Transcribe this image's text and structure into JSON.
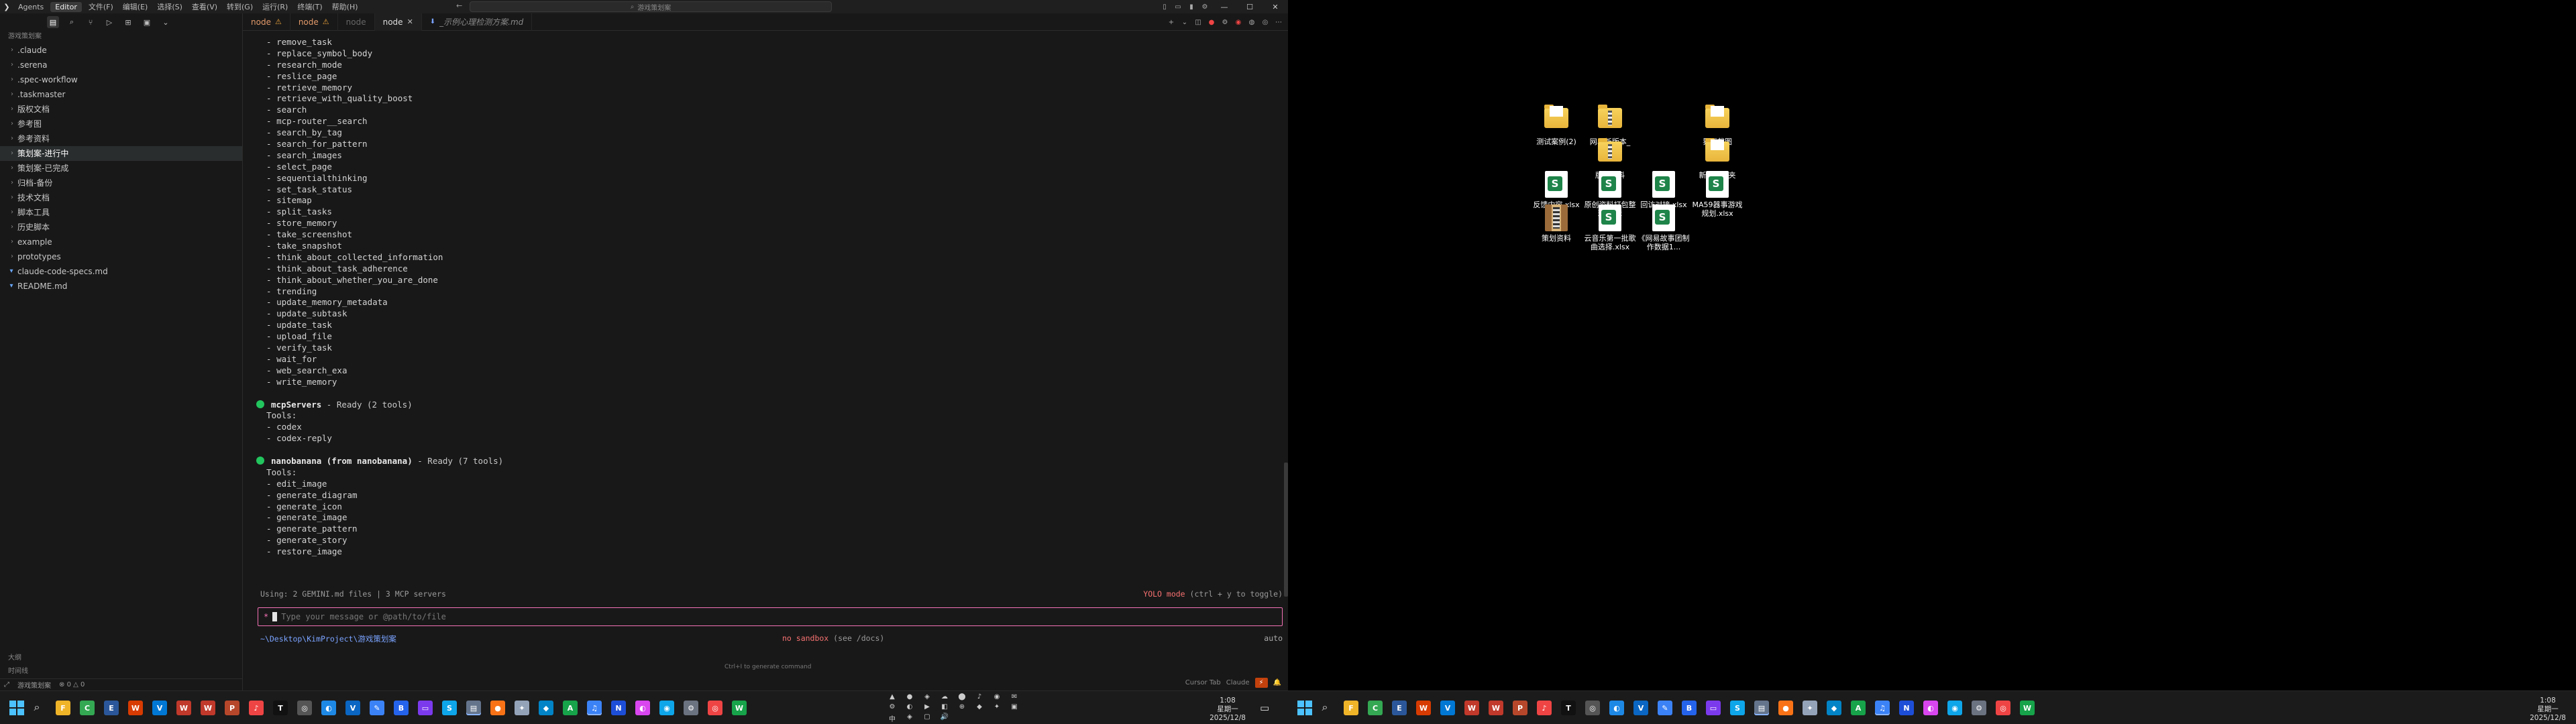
{
  "titlebar": {
    "tabs": [
      "Agents",
      "Editor"
    ],
    "active_tab": "Editor",
    "menus": [
      "文件(F)",
      "编辑(E)",
      "选择(S)",
      "查看(V)",
      "转到(G)",
      "运行(R)",
      "终端(T)",
      "帮助(H)"
    ],
    "search_text": "游戏策划案"
  },
  "sidebar": {
    "header": "游戏策划案",
    "items": [
      {
        "label": ".claude",
        "type": "folder"
      },
      {
        "label": ".serena",
        "type": "folder"
      },
      {
        "label": ".spec-workflow",
        "type": "folder"
      },
      {
        "label": ".taskmaster",
        "type": "folder"
      },
      {
        "label": "版权文档",
        "type": "folder"
      },
      {
        "label": "参考图",
        "type": "folder"
      },
      {
        "label": "参考资料",
        "type": "folder"
      },
      {
        "label": "策划案-进行中",
        "type": "folder",
        "selected": true
      },
      {
        "label": "策划案-已完成",
        "type": "folder"
      },
      {
        "label": "归档-备份",
        "type": "folder"
      },
      {
        "label": "技术文档",
        "type": "folder"
      },
      {
        "label": "脚本工具",
        "type": "folder"
      },
      {
        "label": "历史脚本",
        "type": "folder"
      },
      {
        "label": "example",
        "type": "folder"
      },
      {
        "label": "prototypes",
        "type": "folder"
      },
      {
        "label": "claude-code-specs.md",
        "type": "file"
      },
      {
        "label": "README.md",
        "type": "file"
      }
    ],
    "bottom_items": [
      "大纲",
      "时间线"
    ],
    "footer": {
      "project": "游戏策划案",
      "errors": "0",
      "warnings": "0"
    }
  },
  "editor_tabs": [
    {
      "label": "node",
      "warn": true,
      "style": "warn"
    },
    {
      "label": "node",
      "warn": true,
      "style": "warn"
    },
    {
      "label": "node",
      "warn": false,
      "style": "dim"
    },
    {
      "label": "node",
      "warn": false,
      "style": "active",
      "closable": true
    },
    {
      "label": "_示例心理检测方案.md",
      "warn": false,
      "style": "md"
    }
  ],
  "terminal": {
    "tools_top": [
      "remove_task",
      "replace_symbol_body",
      "research_mode",
      "reslice_page",
      "retrieve_memory",
      "retrieve_with_quality_boost",
      "search",
      "mcp-router__search",
      "search_by_tag",
      "search_for_pattern",
      "search_images",
      "select_page",
      "sequentialthinking",
      "set_task_status",
      "sitemap",
      "split_tasks",
      "store_memory",
      "take_screenshot",
      "take_snapshot",
      "think_about_collected_information",
      "think_about_task_adherence",
      "think_about_whether_you_are_done",
      "trending",
      "update_memory_metadata",
      "update_subtask",
      "update_task",
      "upload_file",
      "verify_task",
      "wait_for",
      "web_search_exa",
      "write_memory"
    ],
    "servers": [
      {
        "name": "mcpServers",
        "status": " - Ready (2 tools)",
        "tools_label": "Tools:",
        "tools": [
          "codex",
          "codex-reply"
        ]
      },
      {
        "name": "nanobanana (from nanobanana)",
        "status": " - Ready (7 tools)",
        "tools_label": "Tools:",
        "tools": [
          "edit_image",
          "generate_diagram",
          "generate_icon",
          "generate_image",
          "generate_pattern",
          "generate_story",
          "restore_image"
        ]
      }
    ],
    "status_left": "Using: 2 GEMINI.md files | 3 MCP servers",
    "yolo": "YOLO mode",
    "yolo_hint": " (ctrl + y to toggle)",
    "prompt": "*",
    "input_placeholder": "Type your message or @path/to/file",
    "cwd": "~\\Desktop\\KimProject\\游戏策划案",
    "sandbox": "no sandbox",
    "sandbox_hint": " (see /docs)",
    "model": "auto",
    "hint": "Ctrl+I to generate command"
  },
  "bottom_status": {
    "cursor_tab": "Cursor Tab",
    "model": "Claude"
  },
  "taskbar": {
    "icons": [
      "F",
      "C",
      "E",
      "W",
      "V",
      "W",
      "W",
      "P",
      "♪",
      "T",
      "◎",
      "◐",
      "V",
      "✎",
      "B",
      "▭",
      "S",
      "▤",
      "●",
      "✦",
      "◆",
      "A",
      "♫",
      "N",
      "◐",
      "◉",
      "⚙",
      "◎",
      "W"
    ],
    "clock1_time": "1:08",
    "clock1_day": "星期一",
    "clock1_date": "2025/12/8",
    "clock2_time": "1:08",
    "clock2_day": "星期一",
    "clock2_date": "2025/12/8",
    "tray": [
      "▲",
      "●",
      "◈",
      "☁",
      "⬤",
      "♪",
      "◉",
      "✉",
      "⚙",
      "◐",
      "▶",
      "◧",
      "⊕",
      "◆",
      "✦",
      "▣",
      "中",
      "◈",
      "▢",
      "🔊"
    ]
  },
  "desktop": {
    "icons": [
      {
        "label": "测试案例(2)",
        "type": "folder"
      },
      {
        "label": "网易新版本_",
        "type": "zipfolder"
      },
      {
        "label": "界面截图",
        "type": "folder"
      },
      {
        "label": "版权资料",
        "type": "zipfolder"
      },
      {
        "label": "新建文件夹",
        "type": "folder"
      },
      {
        "label": "反馈内容.xlsx",
        "type": "xlsx"
      },
      {
        "label": "原创资料打包整理.xlsx",
        "type": "xlsx"
      },
      {
        "label": "回访对接.xlsx",
        "type": "xlsx"
      },
      {
        "label": "MA59器事游戏规划.xlsx",
        "type": "xlsx"
      },
      {
        "label": "策划资料",
        "type": "archive"
      },
      {
        "label": "云音乐第一批歌曲选择.xlsx",
        "type": "xlsx"
      },
      {
        "label": "《网易故事团制作数据1...",
        "type": "xlsx"
      }
    ]
  }
}
